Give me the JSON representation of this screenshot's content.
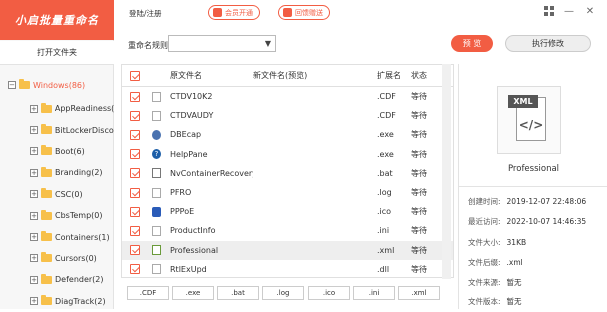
{
  "app": {
    "title": "小启批量重命名",
    "open_folder": "打开文件夹"
  },
  "topbar": {
    "login": "登陆/注册",
    "vip": "会员开通",
    "purchase": "回馈赠送"
  },
  "window": {
    "grid_icon": "grid-icon",
    "minimize": "—",
    "close": "✕"
  },
  "toolbar": {
    "rule_label": "重命名规则",
    "rule_value": "",
    "preview": "预 览",
    "execute": "执行修改"
  },
  "tree": {
    "root": {
      "label": "Windows(86)",
      "expander": "−"
    },
    "items": [
      {
        "label": "AppReadiness(0",
        "expander": "+"
      },
      {
        "label": "BitLockerDiscov",
        "expander": "+"
      },
      {
        "label": "Boot(6)",
        "expander": "+"
      },
      {
        "label": "Branding(2)",
        "expander": "+"
      },
      {
        "label": "CSC(0)",
        "expander": "+"
      },
      {
        "label": "CbsTemp(0)",
        "expander": "+"
      },
      {
        "label": "Containers(1)",
        "expander": "+"
      },
      {
        "label": "Cursors(0)",
        "expander": "+"
      },
      {
        "label": "Defender(2)",
        "expander": "+"
      },
      {
        "label": "DiagTrack(2)",
        "expander": "+"
      }
    ]
  },
  "table": {
    "headers": {
      "name": "原文件名",
      "new_name": "新文件名(预览)",
      "ext": "扩展名",
      "status": "状态"
    },
    "rows": [
      {
        "name": "CTDV10K2",
        "new_name": "",
        "ext": ".CDF",
        "status": "等待",
        "icon": "file-icon"
      },
      {
        "name": "CTDVAUDY",
        "new_name": "",
        "ext": ".CDF",
        "status": "等待",
        "icon": "file-icon"
      },
      {
        "name": "DBEcap",
        "new_name": "",
        "ext": ".exe",
        "status": "等待",
        "icon": "exe-icon"
      },
      {
        "name": "HelpPane",
        "new_name": "",
        "ext": ".exe",
        "status": "等待",
        "icon": "help-icon"
      },
      {
        "name": "NvContainerRecovery",
        "new_name": "",
        "ext": ".bat",
        "status": "等待",
        "icon": "bat-icon"
      },
      {
        "name": "PFRO",
        "new_name": "",
        "ext": ".log",
        "status": "等待",
        "icon": "log-icon"
      },
      {
        "name": "PPPoE",
        "new_name": "",
        "ext": ".ico",
        "status": "等待",
        "icon": "ico-icon"
      },
      {
        "name": "ProductInfo",
        "new_name": "",
        "ext": ".ini",
        "status": "等待",
        "icon": "ini-icon"
      },
      {
        "name": "Professional",
        "new_name": "",
        "ext": ".xml",
        "status": "等待",
        "icon": "xml-icon",
        "selected": true
      },
      {
        "name": "RtlExUpd",
        "new_name": "",
        "ext": ".dll",
        "status": "等待",
        "icon": "dll-icon"
      }
    ]
  },
  "ext_filters": [
    ".CDF",
    ".exe",
    ".bat",
    ".log",
    ".ico",
    ".ini",
    ".xml"
  ],
  "detail": {
    "badge": "XML",
    "glyph": "</>",
    "file_name": "Professional",
    "created_label": "创建时间:",
    "created": "2019-12-07 22:48:06",
    "accessed_label": "最近访问:",
    "accessed": "2022-10-07 14:46:35",
    "size_label": "文件大小:",
    "size": "31KB",
    "ext_label": "文件后缀:",
    "ext": ".xml",
    "source_label": "文件来源:",
    "source": "暂无",
    "version_label": "文件版本:",
    "version": "暂无"
  },
  "colors": {
    "accent": "#f25d43",
    "folder": "#f7c04a"
  }
}
